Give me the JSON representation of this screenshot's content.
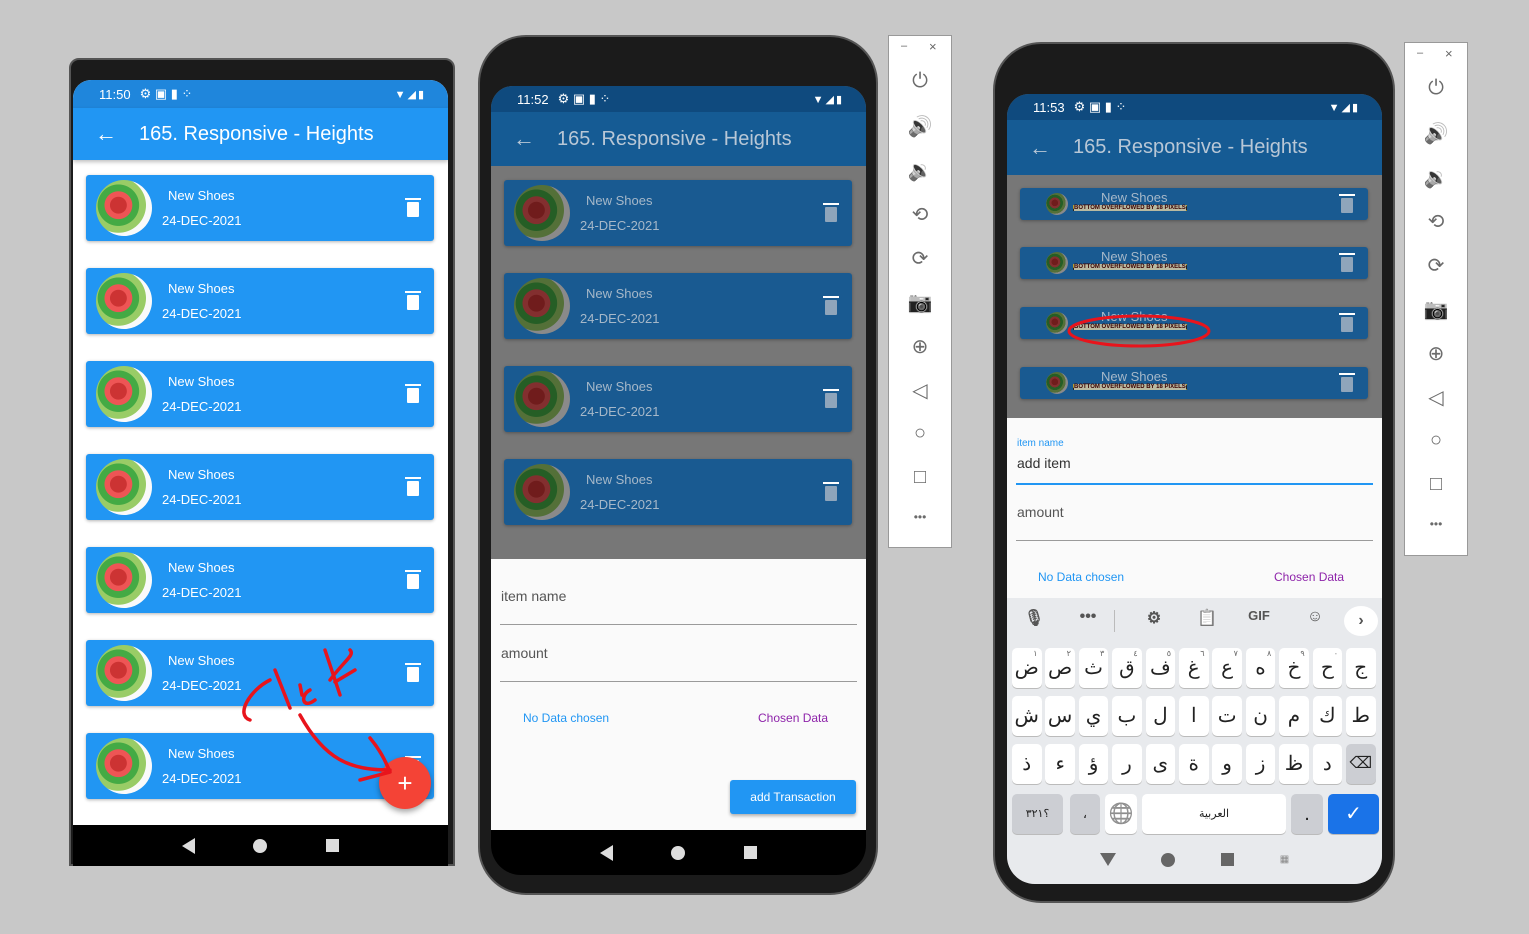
{
  "app_title": "165. Responsive - Heights",
  "phone1": {
    "time": "11:50",
    "items": [
      {
        "title": "New Shoes",
        "date": "24-DEC-2021"
      },
      {
        "title": "New Shoes",
        "date": "24-DEC-2021"
      },
      {
        "title": "New Shoes",
        "date": "24-DEC-2021"
      },
      {
        "title": "New Shoes",
        "date": "24-DEC-2021"
      },
      {
        "title": "New Shoes",
        "date": "24-DEC-2021"
      },
      {
        "title": "New Shoes",
        "date": "24-DEC-2021"
      },
      {
        "title": "New Shoes",
        "date": "24-DEC-2021"
      }
    ],
    "fab_label": "+",
    "annotation": "click"
  },
  "phone2": {
    "time": "11:52",
    "items": [
      {
        "title": "New Shoes",
        "date": "24-DEC-2021"
      },
      {
        "title": "New Shoes",
        "date": "24-DEC-2021"
      },
      {
        "title": "New Shoes",
        "date": "24-DEC-2021"
      },
      {
        "title": "New Shoes",
        "date": "24-DEC-2021"
      }
    ],
    "item_name_placeholder": "item name",
    "amount_placeholder": "amount",
    "no_data": "No Data chosen",
    "chosen_data": "Chosen Data",
    "add_button": "add Transaction"
  },
  "phone3": {
    "time": "11:53",
    "items": [
      {
        "title": "New Shoes",
        "error": "BOTTOM OVERFLOWED BY 18 PIXELS"
      },
      {
        "title": "New Shoes",
        "error": "BOTTOM OVERFLOWED BY 18 PIXELS"
      },
      {
        "title": "New Shoes",
        "error": "BOTTOM OVERFLOWED BY 18 PIXELS"
      },
      {
        "title": "New Shoes",
        "error": "BOTTOM OVERFLOWED BY 18 PIXELS"
      }
    ],
    "item_name_label": "item name",
    "item_name_value": "add item",
    "amount_placeholder": "amount",
    "no_data": "No Data chosen",
    "chosen_data": "Chosen Data",
    "keyboard": {
      "toolbar": [
        "mic-icon",
        "more-icon",
        "gear-icon",
        "clipboard-icon",
        "GIF",
        "sticker-icon",
        "chevron-right-icon"
      ],
      "row1": [
        [
          "ض",
          "١"
        ],
        [
          "ص",
          "٢"
        ],
        [
          "ث",
          "٣"
        ],
        [
          "ق",
          "٤"
        ],
        [
          "ف",
          "٥"
        ],
        [
          "غ",
          "٦"
        ],
        [
          "ع",
          "٧"
        ],
        [
          "ه",
          "٨"
        ],
        [
          "خ",
          "٩"
        ],
        [
          "ح",
          "٠"
        ],
        [
          "ج",
          ""
        ]
      ],
      "row2": [
        "ش",
        "س",
        "ي",
        "ب",
        "ل",
        "ا",
        "ت",
        "ن",
        "م",
        "ك",
        "ط"
      ],
      "row3": [
        "ذ",
        "ء",
        "ؤ",
        "ر",
        "ى",
        "ة",
        "و",
        "ز",
        "ظ",
        "د"
      ],
      "numbers_key": "؟٣٢١",
      "comma_key": "،",
      "space_label": "العربية",
      "period_key": "."
    }
  },
  "emulator_controls": [
    "minimize",
    "close",
    "power-icon",
    "volume-up-icon",
    "volume-down-icon",
    "rotate-left-icon",
    "rotate-right-icon",
    "camera-icon",
    "zoom-icon",
    "back-icon",
    "home-icon",
    "overview-icon",
    "more-icon"
  ],
  "colors": {
    "primary": "#2196f3",
    "purple": "#9c27b0",
    "fab": "#f44336",
    "annotation": "#e8141c"
  }
}
